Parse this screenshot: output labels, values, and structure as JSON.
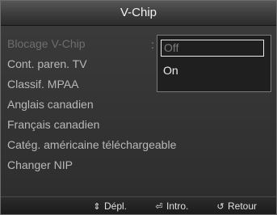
{
  "title": "V-Chip",
  "menu": {
    "items": [
      {
        "label": "Blocage V-Chip",
        "state": "dim"
      },
      {
        "label": "Cont. paren. TV",
        "state": "normal"
      },
      {
        "label": "Classif. MPAA",
        "state": "normal"
      },
      {
        "label": "Anglais canadien",
        "state": "normal"
      },
      {
        "label": "Français canadien",
        "state": "normal"
      },
      {
        "label": "Catég. américaine téléchargeable",
        "state": "normal"
      },
      {
        "label": "Changer NIP",
        "state": "normal"
      }
    ],
    "separator": ":"
  },
  "dropdown": {
    "options": [
      "Off",
      "On"
    ],
    "highlighted": "Off"
  },
  "footer": {
    "navigate_icon": "up-down-arrow-icon",
    "navigate_label": "Dépl.",
    "enter_icon": "enter-icon",
    "enter_label": "Intro.",
    "return_icon": "return-icon",
    "return_label": "Retour"
  },
  "colors": {
    "text": "#b9b9b9",
    "dim_text": "#6e6e6e",
    "title_text": "#f2f2f2",
    "dropdown_bg": "#1f1f1f"
  }
}
